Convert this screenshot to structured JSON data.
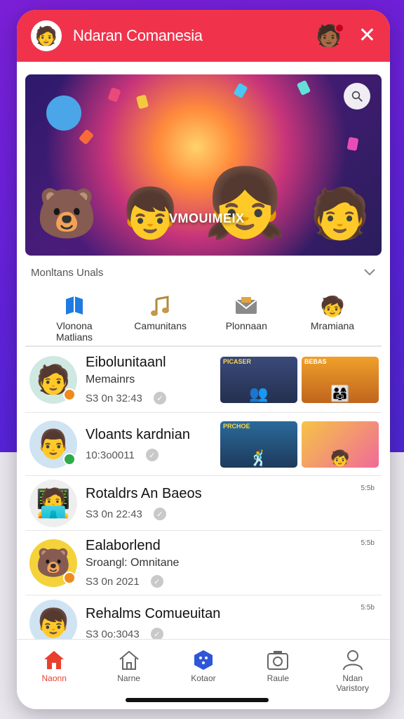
{
  "header": {
    "title": "Ndaran Comanesia",
    "avatar_icon": "user-avatar-icon",
    "profile_icon": "profile-character-icon",
    "close_icon": "close-icon"
  },
  "banner": {
    "logo_text": "VMOUIMEIX",
    "search_icon": "search-icon"
  },
  "section": {
    "label": "Monltans Unals"
  },
  "categories": [
    {
      "label": "Vlonona\nMatlians",
      "icon": "book-icon",
      "color": "#1f7be0"
    },
    {
      "label": "Camunitans",
      "icon": "music-note-icon",
      "color": "#c09a4a"
    },
    {
      "label": "Plonnaan",
      "icon": "mail-icon",
      "color": "#888888"
    },
    {
      "label": "Mramiana",
      "icon": "character-badge-icon",
      "color": "#e23b2e"
    }
  ],
  "list": [
    {
      "name": "Eibolunitaanl",
      "sub": "Memainrs",
      "meta": "S3 0n 32:43",
      "time": "",
      "thumbs": [
        "PICASER",
        "BEBAS"
      ],
      "dot": "#f08a1d"
    },
    {
      "name": "Vloants kardnian",
      "sub": "",
      "meta": "10:3o0011",
      "time": "",
      "thumbs": [
        "PRCHOE",
        ""
      ],
      "dot": "#2faa4a"
    },
    {
      "name": "Rotaldrs An Baeos",
      "sub": "",
      "meta": "S3 0n 22:43",
      "time": "5:5b",
      "thumbs": [],
      "dot": ""
    },
    {
      "name": "Ealaborlend",
      "sub": "Sroangl: Omnitane",
      "meta": "S3 0n 2021",
      "time": "5:5b",
      "thumbs": [],
      "dot": "#f08a1d"
    },
    {
      "name": "Rehalms Comueuitan",
      "sub": "",
      "meta": "S3 0o:3043",
      "time": "5:5b",
      "thumbs": [],
      "dot": ""
    }
  ],
  "nav": [
    {
      "label": "Naonn",
      "icon": "home-filled-icon",
      "active": true
    },
    {
      "label": "Narne",
      "icon": "home-outline-icon",
      "active": false
    },
    {
      "label": "Kotaor",
      "icon": "hexagon-icon",
      "active": false
    },
    {
      "label": "Raule",
      "icon": "camera-icon",
      "active": false
    },
    {
      "label": "Ndan\nVaristory",
      "icon": "person-icon",
      "active": false
    }
  ]
}
